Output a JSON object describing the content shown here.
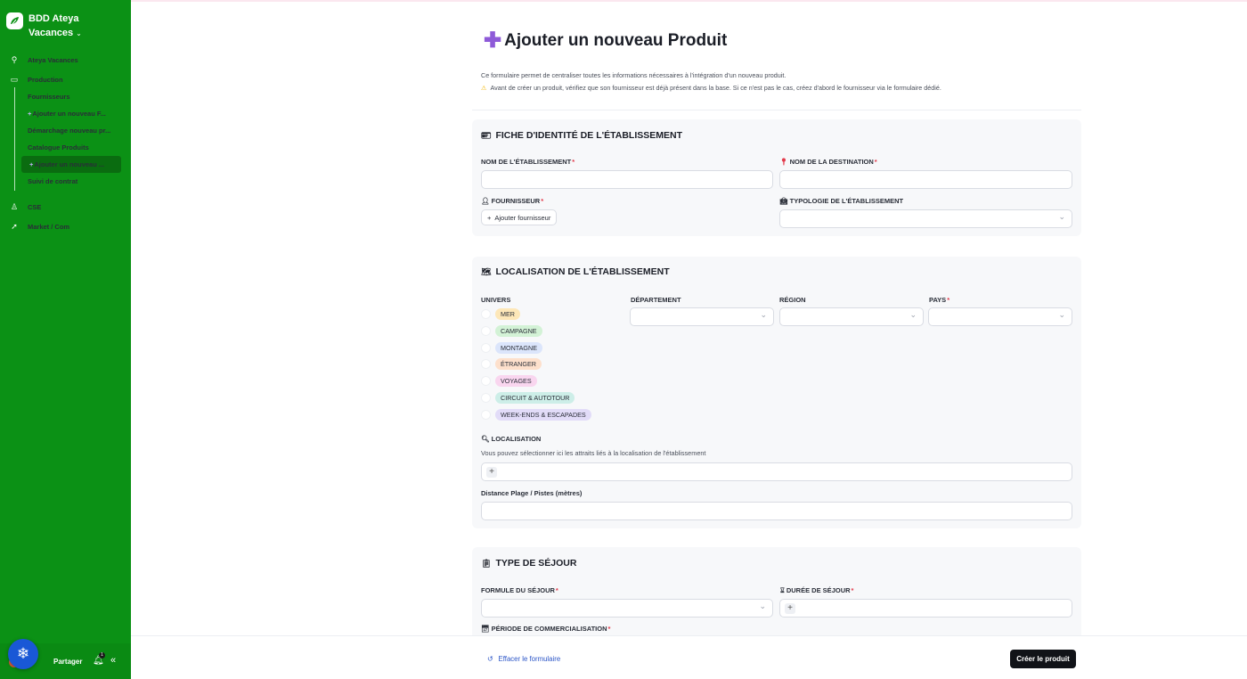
{
  "sidebar": {
    "workspace_name": "BDD Ateya Vacances",
    "items": [
      {
        "label": "Ateya Vacances",
        "icon": "search-icon"
      },
      {
        "label": "Production",
        "icon": "folder-icon"
      },
      {
        "label": "Fournisseurs"
      },
      {
        "label": "Ajouter un nouveau F..."
      },
      {
        "label": "Démarchage nouveau pr..."
      },
      {
        "label": "Catalogue Produits"
      },
      {
        "label": "Ajouter un nouveau ..."
      },
      {
        "label": "Suivi de contrat"
      },
      {
        "label": "CSE",
        "icon": "user-icon"
      },
      {
        "label": "Market / Com",
        "icon": "rocket-icon"
      }
    ],
    "share_label": "Partager",
    "notification_count": "1",
    "help_icon": "snowflake-icon"
  },
  "page": {
    "title": "Ajouter un nouveau Produit",
    "intro_line1": "Ce formulaire permet de centraliser toutes les informations nécessaires à l'intégration d'un nouveau produit.",
    "intro_line2": "Avant de créer un produit, vérifiez que son fournisseur est déjà présent dans la base. Si ce n'est pas le cas, créez d'abord le fournisseur via le formulaire dédié."
  },
  "section_identity": {
    "title": "FICHE D'IDENTITÉ DE L'ÉTABLISSEMENT",
    "name_label": "NOM DE L'ÉTABLISSEMENT",
    "destination_label": "NOM DE LA DESTINATION",
    "supplier_label": "FOURNISSEUR",
    "add_supplier": "Ajouter fournisseur",
    "typology_label": "TYPOLOGIE DE L'ÉTABLISSEMENT"
  },
  "section_location": {
    "title": "LOCALISATION DE L'ÉTABLISSEMENT",
    "univers_label": "UNIVERS",
    "univers_options": [
      {
        "label": "MER",
        "color": "#fde7b8"
      },
      {
        "label": "CAMPAGNE",
        "color": "#d3f2d6"
      },
      {
        "label": "MONTAGNE",
        "color": "#dbe5fb"
      },
      {
        "label": "ÉTRANGER",
        "color": "#fde0cc"
      },
      {
        "label": "VOYAGES",
        "color": "#f9d6ef"
      },
      {
        "label": "CIRCUIT & AUTOTOUR",
        "color": "#cdeee8"
      },
      {
        "label": "WEEK-ENDS & ESCAPADES",
        "color": "#e2dcf8"
      }
    ],
    "departement_label": "DÉPARTEMENT",
    "region_label": "RÉGION",
    "pays_label": "PAYS",
    "localisation_label": "LOCALISATION",
    "localisation_help": "Vous pouvez sélectionner ici les attraits liés à la localisation de l'établissement",
    "distance_label": "Distance Plage / Pistes (mètres)"
  },
  "section_stay": {
    "title": "TYPE DE SÉJOUR",
    "formula_label": "FORMULE DU SÉJOUR",
    "duration_label": "DURÉE DE SÉJOUR",
    "period_label": "PÉRIODE DE COMMERCIALISATION"
  },
  "footer": {
    "reset_label": "Effacer le formulaire",
    "create_label": "Créer le produit"
  }
}
